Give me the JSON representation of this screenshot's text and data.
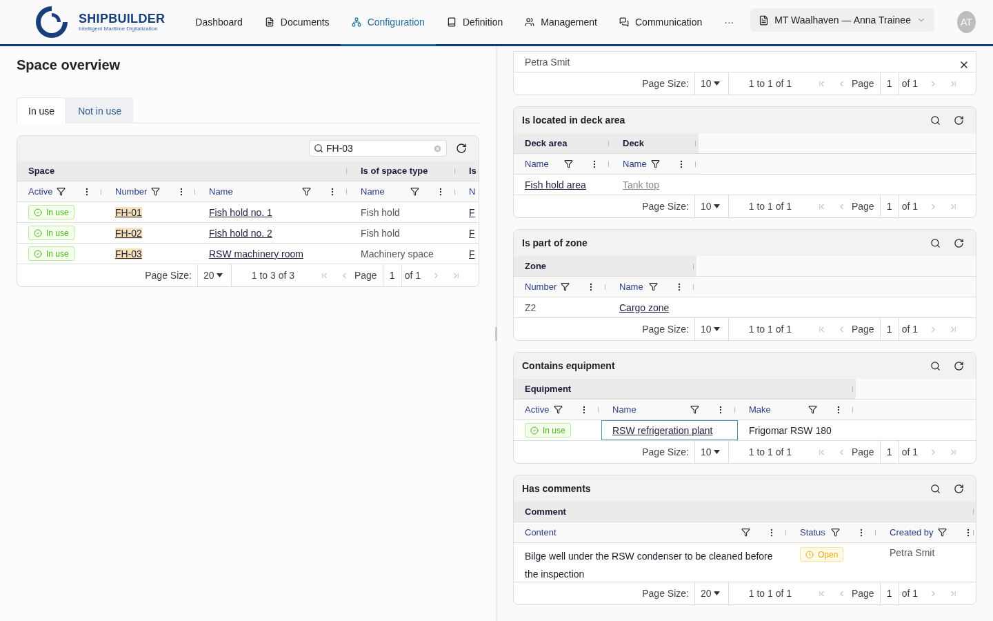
{
  "nav": {
    "brand": "SHIPBUILDER",
    "tagline": "Intelligent Maritime Digitalization",
    "items": [
      {
        "label": "Dashboard",
        "selected": false
      },
      {
        "label": "Documents",
        "selected": false
      },
      {
        "label": "Configuration",
        "selected": true
      },
      {
        "label": "Definition",
        "selected": false
      },
      {
        "label": "Management",
        "selected": false
      },
      {
        "label": "Communication",
        "selected": false
      }
    ],
    "more": "···",
    "context": "MT Waalhaven — Anna Trainee",
    "avatar": "AT"
  },
  "overview": {
    "title": "Space overview",
    "tabs": [
      {
        "label": "In use",
        "selected": true
      },
      {
        "label": "Not in use",
        "selected": false
      }
    ],
    "grid": {
      "search": {
        "value": "FH-03"
      },
      "groups": [
        {
          "label": "Space",
          "columns": [
            {
              "label": "Active"
            },
            {
              "label": "Number"
            },
            {
              "label": "Name"
            }
          ]
        },
        {
          "label": "Is of space type",
          "columns": [
            {
              "label": "Name"
            }
          ]
        },
        {
          "label": "Is",
          "columns": [
            {
              "label": "N"
            }
          ]
        }
      ],
      "rows": [
        {
          "cells": [
            {
              "kind": "active",
              "text": "In use"
            },
            {
              "kind": "match",
              "text": "FH-01"
            },
            {
              "kind": "link",
              "text": "Fish hold no. 1"
            },
            {
              "kind": "muted",
              "text": "Fish hold"
            },
            {
              "kind": "link",
              "text": "F"
            }
          ]
        },
        {
          "cells": [
            {
              "kind": "active",
              "text": "In use"
            },
            {
              "kind": "match",
              "text": "FH-02"
            },
            {
              "kind": "link",
              "text": "Fish hold no. 2"
            },
            {
              "kind": "muted",
              "text": "Fish hold"
            },
            {
              "kind": "link",
              "text": "F"
            }
          ]
        },
        {
          "cells": [
            {
              "kind": "active",
              "text": "In use"
            },
            {
              "kind": "match",
              "text": "FH-03"
            },
            {
              "kind": "link",
              "text": "RSW machinery room"
            },
            {
              "kind": "muted",
              "text": "Machinery space"
            },
            {
              "kind": "link",
              "text": "F"
            }
          ]
        }
      ],
      "pager": {
        "size_label": "Page Size:",
        "size": "20",
        "range": "1 to 3 of 3",
        "page_label": "Page",
        "page": "1",
        "of": "of 1"
      }
    }
  },
  "detail": {
    "top": {
      "rows": [
        {
          "cells": [
            {
              "kind": "muted",
              "text": "Petra Smit"
            }
          ]
        }
      ],
      "pager": {
        "size_label": "Page Size:",
        "size": "10",
        "range": "1 to 1 of 1",
        "page_label": "Page",
        "page": "1",
        "of": "of 1"
      }
    },
    "panels": [
      {
        "title": "Is located in deck area",
        "groups": [
          {
            "label": "Deck area",
            "columns": [
              {
                "label": "Name"
              }
            ]
          },
          {
            "label": "Deck",
            "columns": [
              {
                "label": "Name"
              }
            ]
          }
        ],
        "rows": [
          {
            "cells": [
              {
                "kind": "link",
                "text": "Fish hold area"
              },
              {
                "kind": "faint",
                "text": "Tank top"
              }
            ]
          }
        ],
        "pager": {
          "size_label": "Page Size:",
          "size": "10",
          "range": "1 to 1 of 1",
          "page_label": "Page",
          "page": "1",
          "of": "of 1"
        }
      },
      {
        "title": "Is part of zone",
        "groups": [
          {
            "label": "Zone",
            "columns": [
              {
                "label": "Number"
              },
              {
                "label": "Name"
              }
            ]
          }
        ],
        "rows": [
          {
            "cells": [
              {
                "kind": "muted",
                "text": "Z2"
              },
              {
                "kind": "link",
                "text": "Cargo zone"
              }
            ]
          }
        ],
        "pager": {
          "size_label": "Page Size:",
          "size": "10",
          "range": "1 to 1 of 1",
          "page_label": "Page",
          "page": "1",
          "of": "of 1"
        }
      },
      {
        "title": "Contains equipment",
        "groups": [
          {
            "label": "Equipment",
            "columns": [
              {
                "label": "Active"
              },
              {
                "label": "Name"
              },
              {
                "label": "Make"
              }
            ]
          }
        ],
        "rows": [
          {
            "cells": [
              {
                "kind": "active",
                "text": "In use"
              },
              {
                "kind": "focused",
                "text": "RSW refrigeration plant"
              },
              {
                "kind": "text",
                "text": "Frigomar RSW 180"
              }
            ]
          }
        ],
        "pager": {
          "size_label": "Page Size:",
          "size": "10",
          "range": "1 to 1 of 1",
          "page_label": "Page",
          "page": "1",
          "of": "of 1"
        }
      },
      {
        "title": "Has comments",
        "groups": [
          {
            "label": "Comment",
            "columns": [
              {
                "label": "Content"
              },
              {
                "label": "Status"
              },
              {
                "label": "Created by"
              }
            ]
          }
        ],
        "rows": [
          {
            "cells": [
              {
                "kind": "text",
                "text": "Bilge well under the RSW condenser to be cleaned before the inspection"
              },
              {
                "kind": "open",
                "text": "Open"
              },
              {
                "kind": "muted",
                "text": "Petra Smit"
              }
            ]
          }
        ],
        "pager": {
          "size_label": "Page Size:",
          "size": "20",
          "range": "1 to 1 of 1",
          "page_label": "Page",
          "page": "1",
          "of": "of 1"
        }
      }
    ]
  }
}
